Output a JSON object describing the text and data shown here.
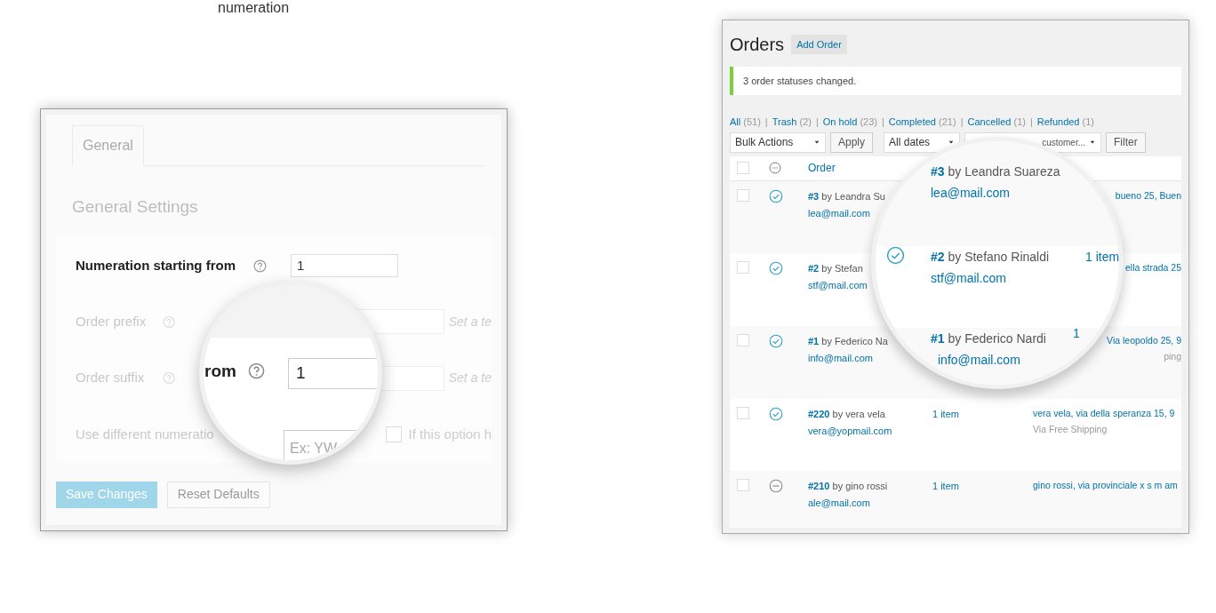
{
  "heading": "numeration",
  "settings_panel": {
    "tabs": [
      {
        "label": "General",
        "selected": true
      }
    ],
    "title": "General Settings",
    "fields": [
      {
        "kind": "text",
        "label": "Numeration starting from",
        "highlighted": true,
        "value": "1"
      },
      {
        "kind": "text",
        "label": "Order prefix",
        "highlighted": false,
        "note": "Set a te"
      },
      {
        "kind": "text",
        "label": "Order suffix",
        "highlighted": false,
        "note": "Set a te"
      },
      {
        "kind": "checkbox",
        "label": "Use different numeratio",
        "highlighted": false,
        "checked": false,
        "note": "If this option h"
      }
    ],
    "buttons": [
      {
        "label": "Save Changes",
        "primary": true
      },
      {
        "label": "Reset Defaults",
        "primary": false
      }
    ],
    "magnifier": {
      "label": "rom",
      "value": "1",
      "placeholder": "Ex: YW"
    }
  },
  "orders_panel": {
    "title": "Orders",
    "add_button": "Add Order",
    "notice": "3 order statuses changed.",
    "separator": "|",
    "filters": [
      {
        "label": "All",
        "count": "(51)"
      },
      {
        "label": "Trash",
        "count": "(2)"
      },
      {
        "label": "On hold",
        "count": "(23)"
      },
      {
        "label": "Completed",
        "count": "(21)"
      },
      {
        "label": "Cancelled",
        "count": "(1)"
      },
      {
        "label": "Refunded",
        "count": "(1)"
      }
    ],
    "bulk_actions": "Bulk Actions",
    "apply": "Apply",
    "dates": "All dates",
    "customer_search": "customer...",
    "filter": "Filter",
    "columns": [
      {
        "kind": "checkbox",
        "checked": false
      },
      {
        "kind": "status"
      },
      {
        "kind": "text",
        "label": "Order"
      }
    ],
    "rows": [
      {
        "checked": false,
        "cancelled": false,
        "order": "#3",
        "customer": "by Leandra Su",
        "email": "lea@mail.com",
        "address": "bueno 25, Buen"
      },
      {
        "checked": false,
        "cancelled": false,
        "order": "#2",
        "customer": "by Stefan",
        "email": "stf@mail.com",
        "address": "ella strada 25"
      },
      {
        "checked": false,
        "cancelled": false,
        "order": "#1",
        "customer": "by Federico Na",
        "email": "info@mail.com",
        "address": "Via leopoldo 25, 9",
        "shipping": "ping"
      },
      {
        "checked": false,
        "cancelled": false,
        "order": "#220",
        "customer": "by vera vela",
        "email": "vera@yopmail.com",
        "items": "1 item",
        "address": "vera vela, via della speranza 15, 9",
        "shipping": "Via Free Shipping"
      },
      {
        "checked": false,
        "cancelled": true,
        "order": "#210",
        "customer": "by gino rossi",
        "email": "ale@mail.com",
        "items": "1 item",
        "address": "gino rossi, via provinciale x s m am"
      }
    ],
    "magnifier": [
      {
        "order": "#3",
        "customer": "by Leandra Suareza",
        "email": "lea@mail.com"
      },
      {
        "cancelled": false,
        "order": "#2",
        "customer": "by Stefano Rinaldi",
        "email": "stf@mail.com",
        "items": "1 item"
      },
      {
        "order": "#1",
        "customer": "by Federico Nardi",
        "email": "info@mail.com",
        "items": "1"
      }
    ]
  }
}
